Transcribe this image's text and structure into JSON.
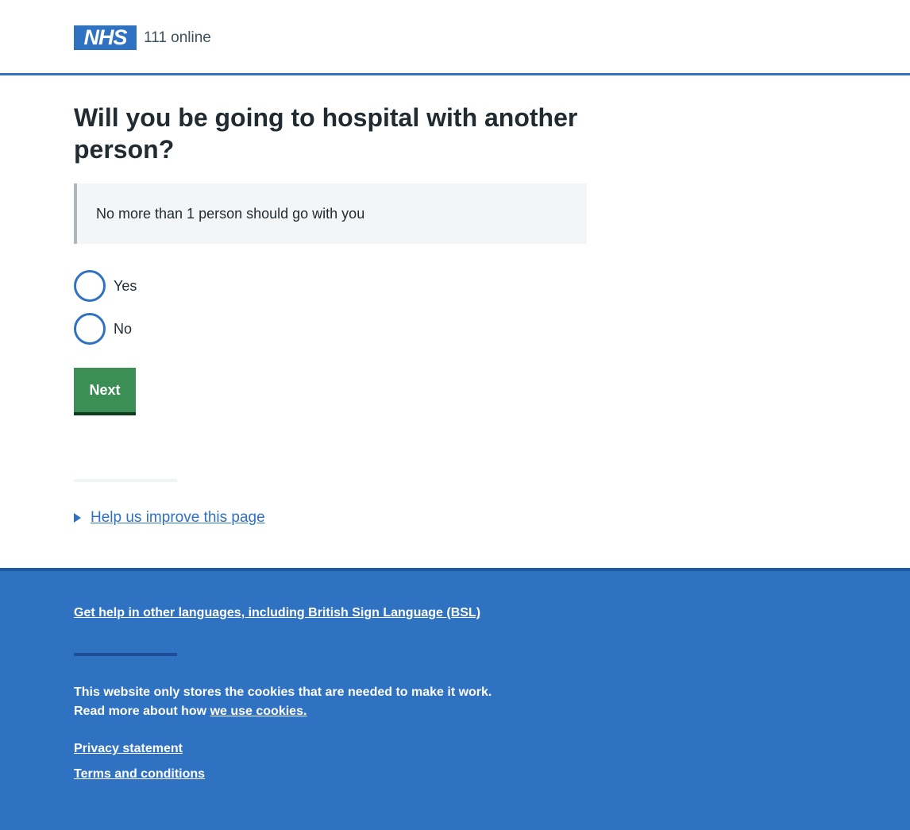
{
  "header": {
    "logo_text": "NHS",
    "service_name": "111 online"
  },
  "question": {
    "title": "Will you be going to hospital with another person?",
    "inset_text": "No more than 1 person should go with you"
  },
  "options": [
    {
      "label": "Yes",
      "selected": false
    },
    {
      "label": "No",
      "selected": false
    }
  ],
  "next_button": {
    "label": "Next"
  },
  "feedback": {
    "link_text": "Help us improve this page"
  },
  "footer": {
    "language_link": "Get help in other languages, including British Sign Language (BSL)",
    "cookie_line1": "This website only stores the cookies that are needed to make it work.",
    "cookie_line2_prefix": "Read more about how ",
    "cookie_link": "we use cookies.",
    "privacy_link": "Privacy statement",
    "terms_link": "Terms and conditions"
  },
  "colors": {
    "nhs_blue": "#2f72c2",
    "button_green": "#3b8f54",
    "text": "#212b32",
    "inset_bg": "#f4f5f7"
  }
}
